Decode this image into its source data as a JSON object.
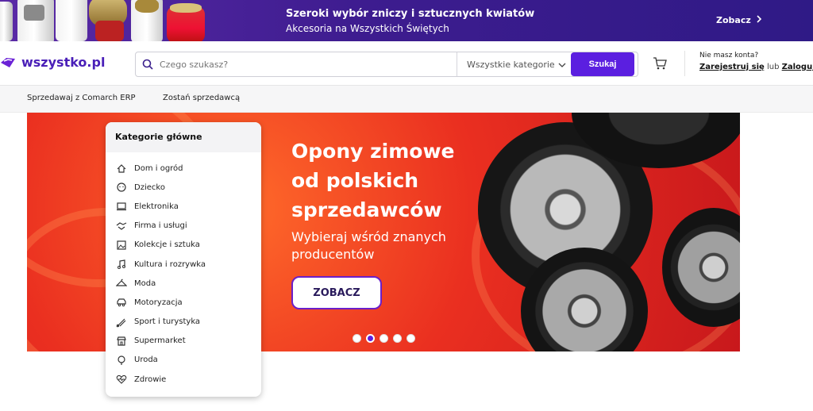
{
  "promo": {
    "line1": "Szeroki wybór zniczy i sztucznych kwiatów",
    "line2": "Akcesoria na Wszystkich Świętych",
    "cta": "Zobacz"
  },
  "header": {
    "logo": "wszystko.pl",
    "search_placeholder": "Czego szukasz?",
    "category_select": "Wszystkie kategorie",
    "search_button": "Szukaj",
    "account_question": "Nie masz konta?",
    "register": "Zarejestruj się",
    "or": "lub",
    "login": "Zaloguj"
  },
  "subnav": {
    "items": [
      "Sprzedawaj z Comarch ERP",
      "Zostań sprzedawcą"
    ]
  },
  "banner": {
    "headline": "Opony zimowe od polskich sprzedawców",
    "subline": "Wybieraj wśród znanych producentów",
    "cta": "ZOBACZ",
    "active_slide": 2,
    "slide_count": 5
  },
  "categories": {
    "title": "Kategorie główne",
    "items": [
      {
        "label": "Dom i ogród",
        "icon": "home-garden-icon"
      },
      {
        "label": "Dziecko",
        "icon": "child-icon"
      },
      {
        "label": "Elektronika",
        "icon": "laptop-icon"
      },
      {
        "label": "Firma i usługi",
        "icon": "handshake-icon"
      },
      {
        "label": "Kolekcje i sztuka",
        "icon": "picture-icon"
      },
      {
        "label": "Kultura i rozrywka",
        "icon": "music-note-icon"
      },
      {
        "label": "Moda",
        "icon": "hanger-icon"
      },
      {
        "label": "Motoryzacja",
        "icon": "car-icon"
      },
      {
        "label": "Sport i turystyka",
        "icon": "shuttlecock-icon"
      },
      {
        "label": "Supermarket",
        "icon": "store-icon"
      },
      {
        "label": "Uroda",
        "icon": "mirror-icon"
      },
      {
        "label": "Zdrowie",
        "icon": "heartbeat-icon"
      }
    ]
  },
  "colors": {
    "brand": "#5b1fe0",
    "promo_bg": "#3d1c8f",
    "banner_red": "#e8311f"
  }
}
